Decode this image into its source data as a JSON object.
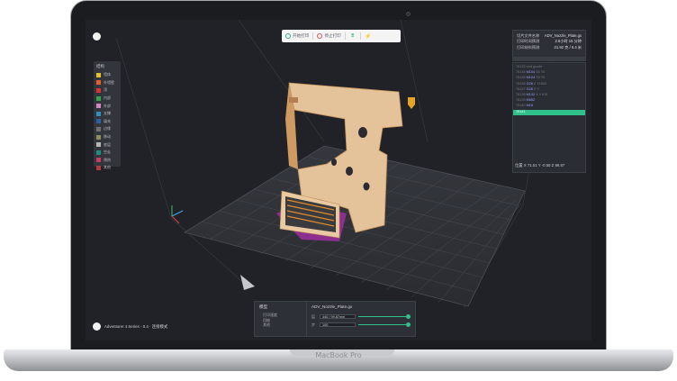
{
  "toolbar": {
    "items": [
      {
        "label": "开始打印",
        "icon": "print-icon"
      },
      {
        "label": "停止打印",
        "icon": "stop-icon"
      }
    ]
  },
  "legend": {
    "title": "结构",
    "items": [
      {
        "label": "墙体",
        "color": "#e7c02b"
      },
      {
        "label": "外墙壁",
        "color": "#e2612b"
      },
      {
        "label": "顶",
        "color": "#d7332f"
      },
      {
        "label": "内部",
        "color": "#35a34a"
      },
      {
        "label": "外部",
        "color": "#d08abf"
      },
      {
        "label": "支撑",
        "color": "#2f8fbf"
      },
      {
        "label": "填充",
        "color": "#2d5fa7"
      },
      {
        "label": "边缘",
        "color": "#6f6f6f"
      },
      {
        "label": "移动",
        "color": "#8e8e5a"
      },
      {
        "label": "底层",
        "color": "#b7b7b7"
      },
      {
        "label": "空走",
        "color": "#1e8f7f"
      },
      {
        "label": "预热",
        "color": "#c73c5f"
      },
      {
        "label": "其他",
        "color": "#b33a3a"
      }
    ]
  },
  "info": {
    "rows": [
      {
        "k": "切片文件名称",
        "v": "ADV_Nozzle_Plate.gx"
      },
      {
        "k": "打印时间预测",
        "v": "2.6小时 15 分钟"
      },
      {
        "k": "打印材料预测",
        "v": "21.92 克 / 6.4 米"
      }
    ]
  },
  "gcode": {
    "lines": [
      {
        "n": "76133",
        "t": "",
        "c": "end gcode"
      },
      {
        "n": "76134",
        "t": "M104",
        "c": "S0 T0"
      },
      {
        "n": "76135",
        "t": "M104",
        "c": "S0 T0"
      },
      {
        "n": "76136",
        "t": "G28",
        "c": "Z Y1000"
      },
      {
        "n": "76137",
        "t": "G28",
        "c": "X Y"
      },
      {
        "n": "76138",
        "t": "M132",
        "c": "X Y A B"
      },
      {
        "n": "76139",
        "t": "M652",
        "c": ""
      },
      {
        "n": "76140",
        "t": "M18",
        "c": ""
      },
      {
        "n": "76141",
        "t": "",
        "c": "",
        "active": true
      }
    ]
  },
  "coords": "位置  X 71.51 Y -0.58 Z 99.87",
  "bottom": {
    "left_title": "模型",
    "options": [
      "打印速度",
      "回抽",
      "其他"
    ],
    "file_name": "ADV_Nozzle_Plate.gx",
    "rows": [
      {
        "k": "层",
        "v": "440 / 99.87mm",
        "fill": 1.0
      },
      {
        "k": "步",
        "v": "100",
        "fill": 1.0
      }
    ]
  },
  "device": "Adventurer 4 Series - 0.4 · 连接模式",
  "brand": "MacBook Pro"
}
